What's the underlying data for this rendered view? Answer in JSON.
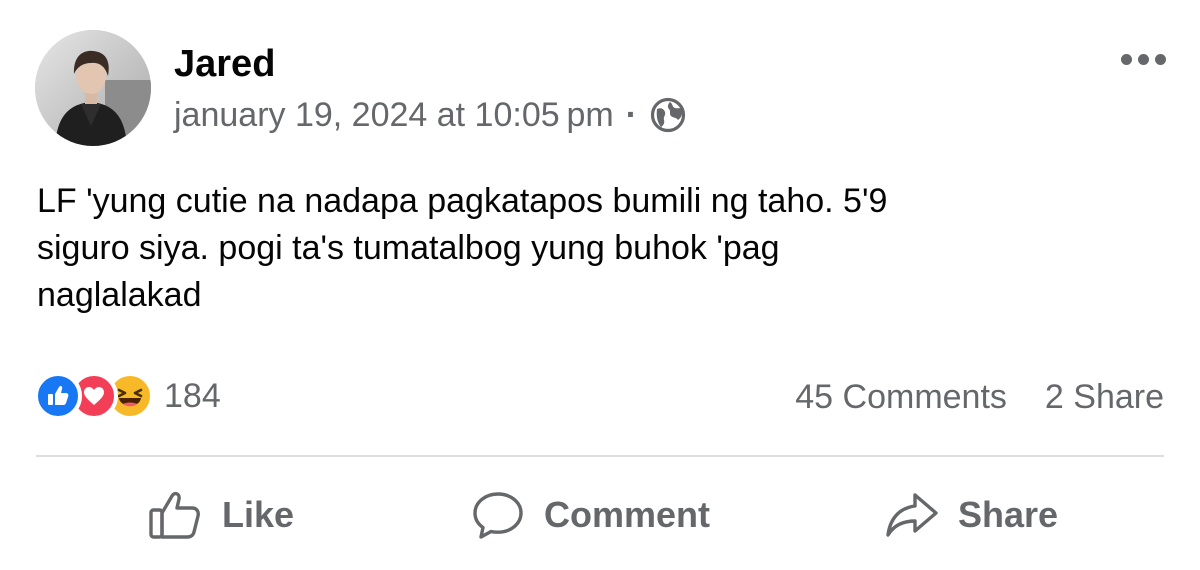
{
  "post": {
    "author": "Jared",
    "timestamp": "january 19, 2024 at 10:05 pm",
    "separator": "·",
    "audience_icon": "globe-icon",
    "more_icon": "more-options-icon",
    "text": "LF 'yung cutie na nadapa pagkatapos bumili ng taho. 5'9\nsiguro siya. pogi ta's tumatalbog yung buhok 'pag\nnaglalakad"
  },
  "stats": {
    "reaction_icons": [
      "like-reaction-icon",
      "love-reaction-icon",
      "haha-reaction-icon"
    ],
    "reaction_count": "184",
    "comments": "45 Comments",
    "shares": "2 Share"
  },
  "actions": {
    "like": "Like",
    "comment": "Comment",
    "share": "Share"
  },
  "colors": {
    "like_blue": "#1877f2",
    "love_red": "#f33e58",
    "haha_yellow": "#f7b928",
    "secondary_text": "#65676b",
    "divider": "#dadde1"
  }
}
